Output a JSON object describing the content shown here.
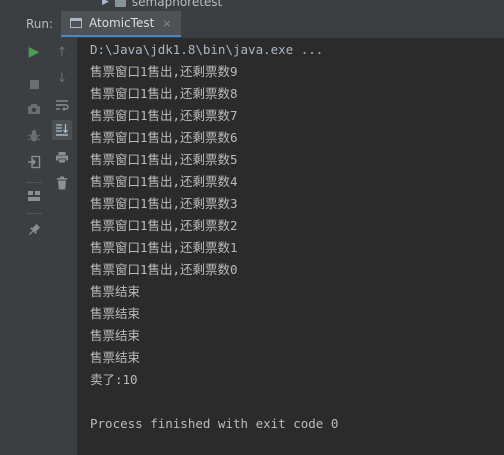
{
  "tree": {
    "folder_label": "semaphoretest"
  },
  "header": {
    "run_label": "Run:",
    "tab_label": "AtomicTest",
    "tab_close": "×"
  },
  "toolbar": {
    "colors": {
      "run_green": "#499c54",
      "icon_gray": "#8a8f93"
    }
  },
  "console": {
    "command": "D:\\Java\\jdk1.8\\bin\\java.exe ...",
    "lines": [
      "售票窗口1售出,还剩票数9",
      "售票窗口1售出,还剩票数8",
      "售票窗口1售出,还剩票数7",
      "售票窗口1售出,还剩票数6",
      "售票窗口1售出,还剩票数5",
      "售票窗口1售出,还剩票数4",
      "售票窗口1售出,还剩票数3",
      "售票窗口1售出,还剩票数2",
      "售票窗口1售出,还剩票数1",
      "售票窗口1售出,还剩票数0",
      "售票结束",
      "售票结束",
      "售票结束",
      "售票结束",
      "卖了:10"
    ],
    "exit_message": "Process finished with exit code 0"
  }
}
